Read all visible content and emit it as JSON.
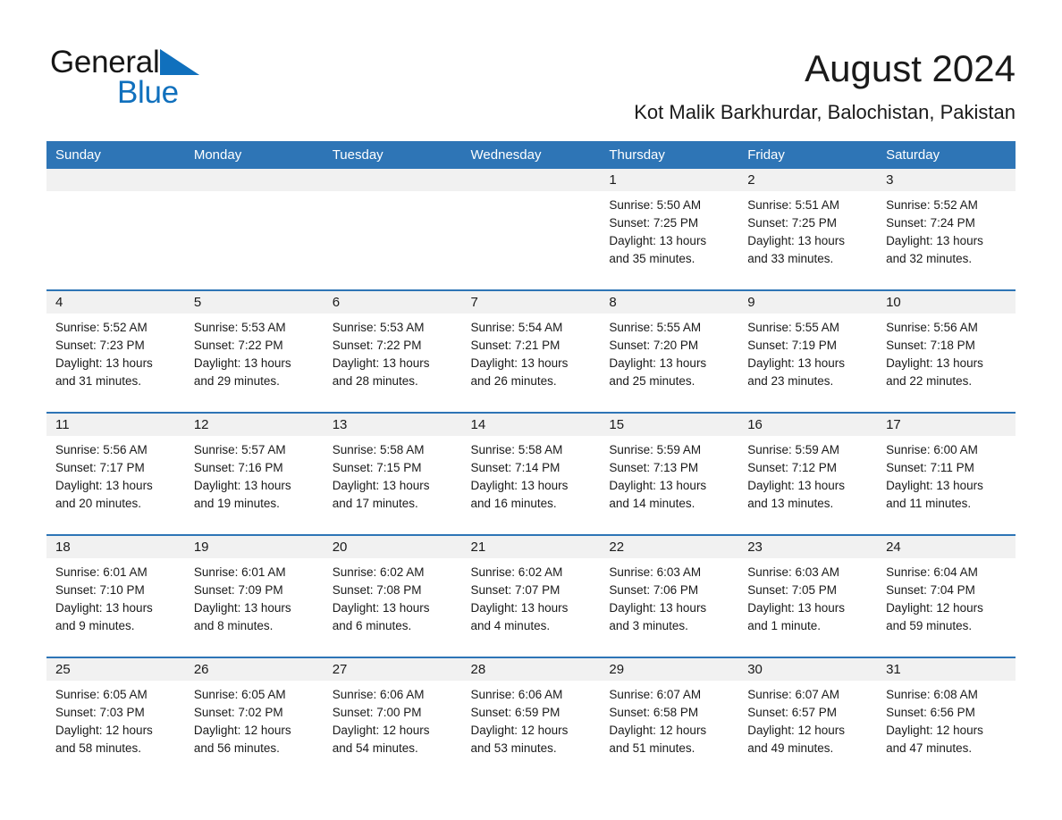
{
  "brand": {
    "name_part1": "General",
    "name_part2": "Blue",
    "triangle_color": "#1070BD",
    "text_color": "#161616"
  },
  "header": {
    "title": "August 2024",
    "subtitle": "Kot Malik Barkhurdar, Balochistan, Pakistan"
  },
  "colors": {
    "header_blue": "#2E75B6",
    "row_separator": "#2E75B6",
    "daynum_background": "#F1F1F1",
    "text": "#1a1a1a"
  },
  "calendar": {
    "weekday_headers": [
      "Sunday",
      "Monday",
      "Tuesday",
      "Wednesday",
      "Thursday",
      "Friday",
      "Saturday"
    ],
    "weeks": [
      [
        {
          "day": "",
          "sunrise": "",
          "sunset": "",
          "daylight1": "",
          "daylight2": ""
        },
        {
          "day": "",
          "sunrise": "",
          "sunset": "",
          "daylight1": "",
          "daylight2": ""
        },
        {
          "day": "",
          "sunrise": "",
          "sunset": "",
          "daylight1": "",
          "daylight2": ""
        },
        {
          "day": "",
          "sunrise": "",
          "sunset": "",
          "daylight1": "",
          "daylight2": ""
        },
        {
          "day": "1",
          "sunrise": "Sunrise: 5:50 AM",
          "sunset": "Sunset: 7:25 PM",
          "daylight1": "Daylight: 13 hours",
          "daylight2": "and 35 minutes."
        },
        {
          "day": "2",
          "sunrise": "Sunrise: 5:51 AM",
          "sunset": "Sunset: 7:25 PM",
          "daylight1": "Daylight: 13 hours",
          "daylight2": "and 33 minutes."
        },
        {
          "day": "3",
          "sunrise": "Sunrise: 5:52 AM",
          "sunset": "Sunset: 7:24 PM",
          "daylight1": "Daylight: 13 hours",
          "daylight2": "and 32 minutes."
        }
      ],
      [
        {
          "day": "4",
          "sunrise": "Sunrise: 5:52 AM",
          "sunset": "Sunset: 7:23 PM",
          "daylight1": "Daylight: 13 hours",
          "daylight2": "and 31 minutes."
        },
        {
          "day": "5",
          "sunrise": "Sunrise: 5:53 AM",
          "sunset": "Sunset: 7:22 PM",
          "daylight1": "Daylight: 13 hours",
          "daylight2": "and 29 minutes."
        },
        {
          "day": "6",
          "sunrise": "Sunrise: 5:53 AM",
          "sunset": "Sunset: 7:22 PM",
          "daylight1": "Daylight: 13 hours",
          "daylight2": "and 28 minutes."
        },
        {
          "day": "7",
          "sunrise": "Sunrise: 5:54 AM",
          "sunset": "Sunset: 7:21 PM",
          "daylight1": "Daylight: 13 hours",
          "daylight2": "and 26 minutes."
        },
        {
          "day": "8",
          "sunrise": "Sunrise: 5:55 AM",
          "sunset": "Sunset: 7:20 PM",
          "daylight1": "Daylight: 13 hours",
          "daylight2": "and 25 minutes."
        },
        {
          "day": "9",
          "sunrise": "Sunrise: 5:55 AM",
          "sunset": "Sunset: 7:19 PM",
          "daylight1": "Daylight: 13 hours",
          "daylight2": "and 23 minutes."
        },
        {
          "day": "10",
          "sunrise": "Sunrise: 5:56 AM",
          "sunset": "Sunset: 7:18 PM",
          "daylight1": "Daylight: 13 hours",
          "daylight2": "and 22 minutes."
        }
      ],
      [
        {
          "day": "11",
          "sunrise": "Sunrise: 5:56 AM",
          "sunset": "Sunset: 7:17 PM",
          "daylight1": "Daylight: 13 hours",
          "daylight2": "and 20 minutes."
        },
        {
          "day": "12",
          "sunrise": "Sunrise: 5:57 AM",
          "sunset": "Sunset: 7:16 PM",
          "daylight1": "Daylight: 13 hours",
          "daylight2": "and 19 minutes."
        },
        {
          "day": "13",
          "sunrise": "Sunrise: 5:58 AM",
          "sunset": "Sunset: 7:15 PM",
          "daylight1": "Daylight: 13 hours",
          "daylight2": "and 17 minutes."
        },
        {
          "day": "14",
          "sunrise": "Sunrise: 5:58 AM",
          "sunset": "Sunset: 7:14 PM",
          "daylight1": "Daylight: 13 hours",
          "daylight2": "and 16 minutes."
        },
        {
          "day": "15",
          "sunrise": "Sunrise: 5:59 AM",
          "sunset": "Sunset: 7:13 PM",
          "daylight1": "Daylight: 13 hours",
          "daylight2": "and 14 minutes."
        },
        {
          "day": "16",
          "sunrise": "Sunrise: 5:59 AM",
          "sunset": "Sunset: 7:12 PM",
          "daylight1": "Daylight: 13 hours",
          "daylight2": "and 13 minutes."
        },
        {
          "day": "17",
          "sunrise": "Sunrise: 6:00 AM",
          "sunset": "Sunset: 7:11 PM",
          "daylight1": "Daylight: 13 hours",
          "daylight2": "and 11 minutes."
        }
      ],
      [
        {
          "day": "18",
          "sunrise": "Sunrise: 6:01 AM",
          "sunset": "Sunset: 7:10 PM",
          "daylight1": "Daylight: 13 hours",
          "daylight2": "and 9 minutes."
        },
        {
          "day": "19",
          "sunrise": "Sunrise: 6:01 AM",
          "sunset": "Sunset: 7:09 PM",
          "daylight1": "Daylight: 13 hours",
          "daylight2": "and 8 minutes."
        },
        {
          "day": "20",
          "sunrise": "Sunrise: 6:02 AM",
          "sunset": "Sunset: 7:08 PM",
          "daylight1": "Daylight: 13 hours",
          "daylight2": "and 6 minutes."
        },
        {
          "day": "21",
          "sunrise": "Sunrise: 6:02 AM",
          "sunset": "Sunset: 7:07 PM",
          "daylight1": "Daylight: 13 hours",
          "daylight2": "and 4 minutes."
        },
        {
          "day": "22",
          "sunrise": "Sunrise: 6:03 AM",
          "sunset": "Sunset: 7:06 PM",
          "daylight1": "Daylight: 13 hours",
          "daylight2": "and 3 minutes."
        },
        {
          "day": "23",
          "sunrise": "Sunrise: 6:03 AM",
          "sunset": "Sunset: 7:05 PM",
          "daylight1": "Daylight: 13 hours",
          "daylight2": "and 1 minute."
        },
        {
          "day": "24",
          "sunrise": "Sunrise: 6:04 AM",
          "sunset": "Sunset: 7:04 PM",
          "daylight1": "Daylight: 12 hours",
          "daylight2": "and 59 minutes."
        }
      ],
      [
        {
          "day": "25",
          "sunrise": "Sunrise: 6:05 AM",
          "sunset": "Sunset: 7:03 PM",
          "daylight1": "Daylight: 12 hours",
          "daylight2": "and 58 minutes."
        },
        {
          "day": "26",
          "sunrise": "Sunrise: 6:05 AM",
          "sunset": "Sunset: 7:02 PM",
          "daylight1": "Daylight: 12 hours",
          "daylight2": "and 56 minutes."
        },
        {
          "day": "27",
          "sunrise": "Sunrise: 6:06 AM",
          "sunset": "Sunset: 7:00 PM",
          "daylight1": "Daylight: 12 hours",
          "daylight2": "and 54 minutes."
        },
        {
          "day": "28",
          "sunrise": "Sunrise: 6:06 AM",
          "sunset": "Sunset: 6:59 PM",
          "daylight1": "Daylight: 12 hours",
          "daylight2": "and 53 minutes."
        },
        {
          "day": "29",
          "sunrise": "Sunrise: 6:07 AM",
          "sunset": "Sunset: 6:58 PM",
          "daylight1": "Daylight: 12 hours",
          "daylight2": "and 51 minutes."
        },
        {
          "day": "30",
          "sunrise": "Sunrise: 6:07 AM",
          "sunset": "Sunset: 6:57 PM",
          "daylight1": "Daylight: 12 hours",
          "daylight2": "and 49 minutes."
        },
        {
          "day": "31",
          "sunrise": "Sunrise: 6:08 AM",
          "sunset": "Sunset: 6:56 PM",
          "daylight1": "Daylight: 12 hours",
          "daylight2": "and 47 minutes."
        }
      ]
    ]
  }
}
